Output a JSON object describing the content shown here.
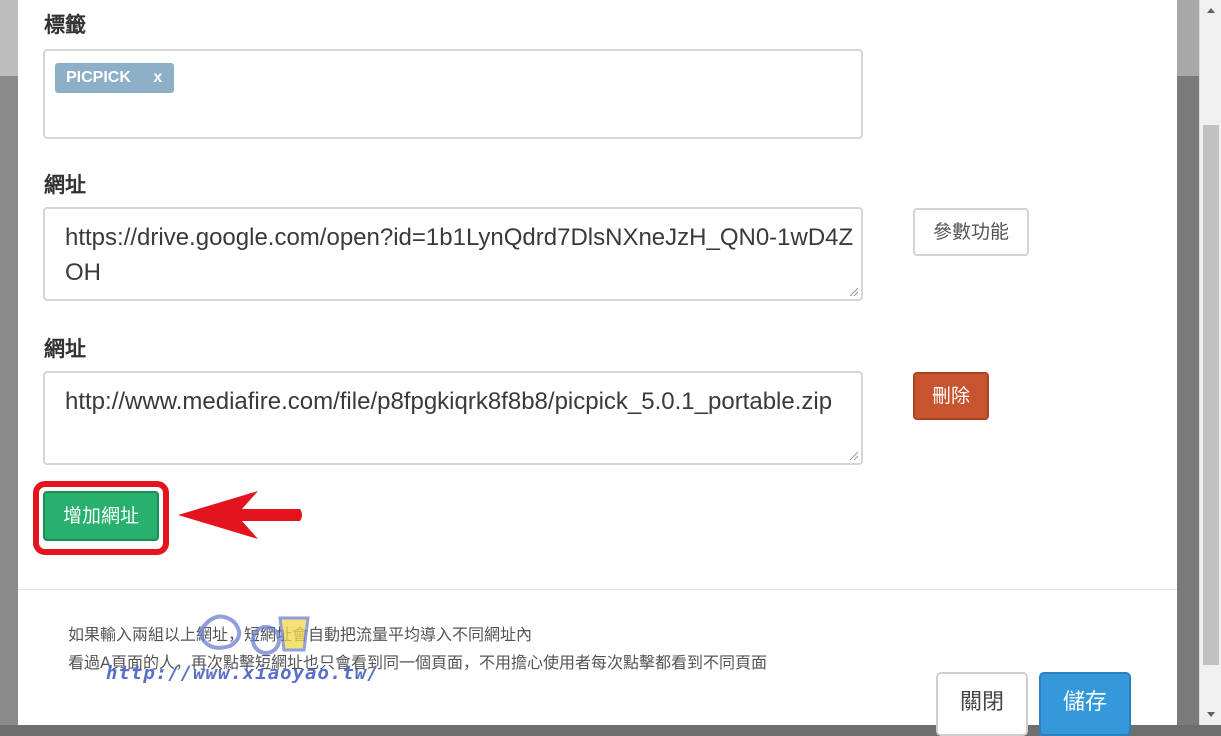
{
  "tags_section": {
    "label": "標籤",
    "tags": [
      {
        "text": "PICPICK",
        "remove": "x"
      }
    ]
  },
  "url_1": {
    "label": "網址",
    "value": "https://drive.google.com/open?id=1b1LynQdrd7DlsNXneJzH_QN0-1wD4ZOH",
    "button": "參數功能"
  },
  "url_2": {
    "label": "網址",
    "value": "http://www.mediafire.com/file/p8fpgkiqrk8f8b8/picpick_5.0.1_portable.zip",
    "button": "刪除"
  },
  "add_url_button": "增加網址",
  "notes": [
    "如果輸入兩組以上網址，短網址會自動把流量平均導入不同網址內",
    "看過A頁面的人，再次點擊短網址也只會看到同一個頁面，不用擔心使用者每次點擊都看到不同頁面"
  ],
  "watermark": {
    "url": "http://www.xiaoyao.tw/"
  },
  "footer": {
    "close": "關閉",
    "save": "儲存"
  },
  "colors": {
    "tag": "#8eafc8",
    "delete": "#c8542f",
    "add": "#27b06e",
    "save": "#3498db",
    "highlight": "#e3141e"
  }
}
